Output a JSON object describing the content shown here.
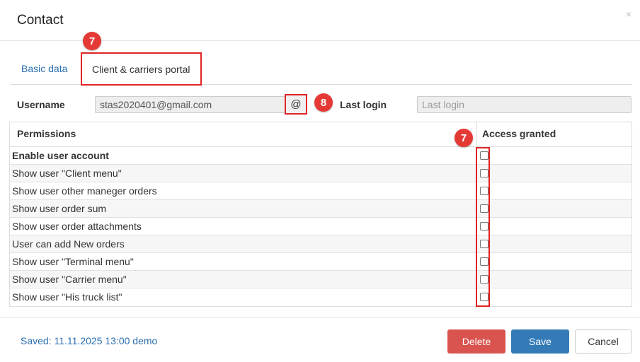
{
  "header": {
    "title": "Contact",
    "close_label": "×"
  },
  "tabs": [
    {
      "label": "Basic data"
    },
    {
      "label": "Client & carriers portal"
    }
  ],
  "annotations": {
    "tab_badge": "7",
    "at_badge": "8",
    "checkbox_badge": "7"
  },
  "login": {
    "username_label": "Username",
    "username_value": "stas2020401@gmail.com",
    "at_button": "@",
    "last_login_label": "Last login",
    "last_login_placeholder": "Last login"
  },
  "table": {
    "headers": {
      "permissions": "Permissions",
      "access": "Access granted"
    },
    "rows": [
      {
        "label": "Enable user account",
        "checked": false
      },
      {
        "label": "Show user \"Client menu\"",
        "checked": false
      },
      {
        "label": "Show user other maneger orders",
        "checked": false
      },
      {
        "label": "Show user order sum",
        "checked": false
      },
      {
        "label": "Show user order attachments",
        "checked": false
      },
      {
        "label": "User can add New orders",
        "checked": false
      },
      {
        "label": "Show user \"Terminal menu\"",
        "checked": false
      },
      {
        "label": "Show user \"Carrier menu\"",
        "checked": false
      },
      {
        "label": "Show user \"His truck list\"",
        "checked": false
      }
    ]
  },
  "footer": {
    "saved_text": "Saved: 11.11.2025 13:00 demo",
    "delete_label": "Delete",
    "save_label": "Save",
    "cancel_label": "Cancel"
  },
  "colors": {
    "accent": "#337ab7",
    "danger": "#d9534f",
    "highlight": "#e02424",
    "badge": "#e53935"
  }
}
